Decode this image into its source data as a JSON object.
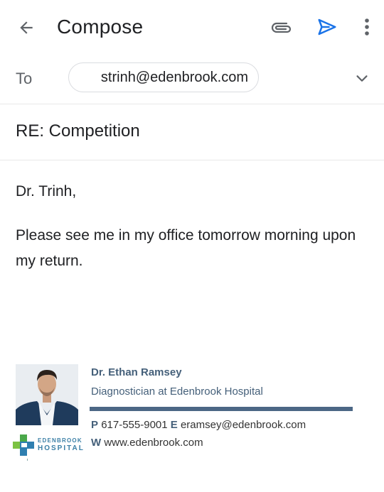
{
  "topbar": {
    "title": "Compose",
    "icons": [
      "back-arrow-icon",
      "paperclip-icon",
      "send-icon",
      "more-vert-icon"
    ],
    "accent_color": "#1a73e8"
  },
  "to": {
    "label": "To",
    "recipient": "strinh@edenbrook.com",
    "expand_icon": "chevron-down-icon"
  },
  "subject": "RE: Competition",
  "body": {
    "greeting": "Dr. Trinh,",
    "message": "Please see me in my office tomorrow morning upon my return."
  },
  "signature": {
    "name": "Dr. Ethan Ramsey",
    "role": "Diagnostician at  Edenbrook Hospital",
    "phone_key": "P",
    "phone": "617-555-9001",
    "email_key": "E",
    "email": "eramsey@edenbrook.com",
    "web_key": "W",
    "web": "www.edenbrook.com",
    "logo_line1": "EDENBROOK",
    "logo_line2": "HOSPITAL",
    "accent_color": "#4c6785"
  }
}
